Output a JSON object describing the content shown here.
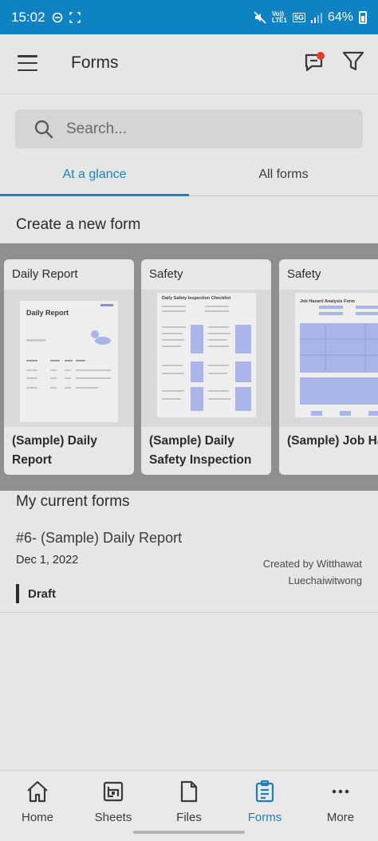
{
  "status_bar": {
    "time": "15:02",
    "network_top": "Vo))",
    "network_bottom": "LTE1",
    "network_gen": "5G",
    "battery": "64%"
  },
  "app_bar": {
    "title": "Forms"
  },
  "search": {
    "placeholder": "Search..."
  },
  "tabs": [
    {
      "label": "At a glance",
      "active": true
    },
    {
      "label": "All forms",
      "active": false
    }
  ],
  "create_section": {
    "title": "Create a new form"
  },
  "templates": [
    {
      "category": "Daily Report",
      "title": "(Sample) Daily Report",
      "preview_heading": "Daily Report"
    },
    {
      "category": "Safety",
      "title": "(Sample) Daily Safety Inspection",
      "preview_heading": "Daily Safety Inspection Checklist"
    },
    {
      "category": "Safety",
      "title": "(Sample) Job Hazard Analysis",
      "preview_heading": "Job Hazard Analysis Form"
    }
  ],
  "current_section": {
    "title": "My current forms"
  },
  "current_forms": [
    {
      "title": "#6- (Sample) Daily Report",
      "date": "Dec 1, 2022",
      "creator_line1": "Created by Witthawat",
      "creator_line2": "Luechaiwitwong",
      "status": "Draft"
    }
  ],
  "bottom_nav": [
    {
      "label": "Home",
      "icon": "home-icon",
      "active": false
    },
    {
      "label": "Sheets",
      "icon": "sheets-icon",
      "active": false
    },
    {
      "label": "Files",
      "icon": "files-icon",
      "active": false
    },
    {
      "label": "Forms",
      "icon": "forms-clipboard-icon",
      "active": true
    },
    {
      "label": "More",
      "icon": "more-dots-icon",
      "active": false
    }
  ],
  "colors": {
    "status_bar": "#0e82c3",
    "accent": "#1f7fb8",
    "notification_dot": "#e43b2c",
    "preview_highlight": "#a9b4e8"
  }
}
